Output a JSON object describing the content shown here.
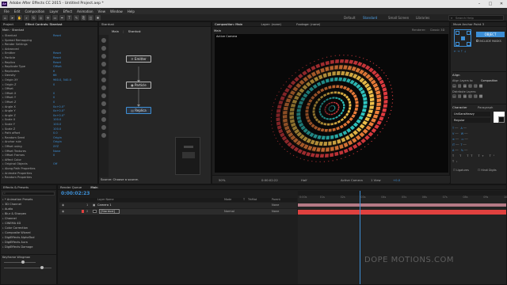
{
  "window": {
    "title": "Adobe After Effects CC 2015 - Untitled Project.aep *",
    "app_badge": "Ae",
    "controls": [
      "–",
      "□",
      "✕"
    ]
  },
  "menu": [
    "File",
    "Edit",
    "Composition",
    "Layer",
    "Effect",
    "Animation",
    "View",
    "Window",
    "Help"
  ],
  "toolbar": {
    "workspaces": [
      "Default",
      "Standard",
      "Small Screen",
      "Libraries"
    ],
    "search_placeholder": "Search Help"
  },
  "project_panel": {
    "tab": "Project",
    "effect_controls_tab": "Effect Controls: Stardust",
    "header": "Main · Stardust",
    "rows": [
      {
        "label": "Stardust",
        "value": "Reset"
      },
      {
        "label": "Spread Remapping",
        "value": ""
      },
      {
        "label": "Render Settings",
        "value": ""
      },
      {
        "label": "Advanced",
        "value": ""
      },
      {
        "label": "Emitter",
        "value": "Reset"
      },
      {
        "label": "Particle",
        "value": "Reset"
      },
      {
        "label": "Replica",
        "value": "Reset"
      },
      {
        "label": "Replicate Type",
        "value": "Offset"
      },
      {
        "label": "Replicates",
        "value": "6"
      },
      {
        "label": "Density",
        "value": "66"
      },
      {
        "label": "Origin XY",
        "value": "960.0, 540.0"
      },
      {
        "label": "Origin Z",
        "value": "0"
      },
      {
        "label": "Offset",
        "value": ""
      },
      {
        "label": "Offset X",
        "value": "0"
      },
      {
        "label": "Offset Y",
        "value": "0"
      },
      {
        "label": "Offset Z",
        "value": "0"
      },
      {
        "label": "Angle X",
        "value": "0x+0.0°"
      },
      {
        "label": "Angle Y",
        "value": "0x+0.0°"
      },
      {
        "label": "Angle Z",
        "value": "0x+0.0°"
      },
      {
        "label": "Scale X",
        "value": "100.0"
      },
      {
        "label": "Scale Y",
        "value": "100.0"
      },
      {
        "label": "Scale Z",
        "value": "100.0"
      },
      {
        "label": "Path offset",
        "value": "0.0"
      },
      {
        "label": "Random Seed",
        "value": "Origin"
      },
      {
        "label": "Anchor rule",
        "value": "Origin"
      },
      {
        "label": "Offset using",
        "value": "XYZ"
      },
      {
        "label": "Offset Textures",
        "value": "None"
      },
      {
        "label": "Offset Frames",
        "value": "0"
      },
      {
        "label": "Affect Color",
        "value": ""
      },
      {
        "label": "Original Objects",
        "value": "Off"
      },
      {
        "label": "Along Path Properties",
        "value": ""
      },
      {
        "label": "Animate Properties",
        "value": ""
      },
      {
        "label": "Random Properties",
        "value": ""
      }
    ]
  },
  "flow_panel": {
    "tab": "Stardust",
    "breadcrumb": [
      "Main",
      "Stardust"
    ],
    "nodes": [
      "Emitter",
      "Particle",
      "Replica"
    ],
    "status": "Source: Choose a source."
  },
  "comp_panel": {
    "tabs": [
      "Composition: Main",
      "Layer: (none)",
      "Footage: (none)"
    ],
    "sub_tabs": [
      "Main"
    ],
    "renderer": "Renderer:",
    "renderer_value": "Classic 3D",
    "camera_label": "Active Camera",
    "footer": {
      "zoom": "50%",
      "timecode": "0:00:02:22",
      "quality": "Half",
      "view": "Active Camera",
      "views": "1 View",
      "exposure": "+0.0"
    }
  },
  "right_panel": {
    "tab": "Move Anchor Point 3",
    "object_button": "OBJECT",
    "checkbox_label": "INCLUDE MASKS",
    "align_tab": "Align",
    "align_label": "Align Layers to:",
    "align_target": "Composition",
    "distribute_label": "Distribute Layers:",
    "character_tab": "Character",
    "paragraph_tab": "Paragraph",
    "font": "UniSansHeavy",
    "font_style": "Regular",
    "ligatures": "Ligatures",
    "hindi_digits": "Hindi Digits"
  },
  "effects_panel": {
    "tab": "Effects & Presets",
    "search_placeholder": "",
    "items": [
      "* Animation Presets",
      "3D Channel",
      "Audio",
      "Blur & Sharpen",
      "Channel",
      "CINEMA 4D",
      "Color Correction",
      "Composite Wizard",
      "DigiEffects AlphaTool",
      "DigiEffects Aura",
      "DigiEffects Damage"
    ],
    "keyframe_tab": "Keyframe Wingman"
  },
  "timeline": {
    "tabs": [
      "Render Queue",
      "Main"
    ],
    "timecode": "0:00:02:23",
    "columns": [
      "Layer Name",
      "Mode",
      "T",
      "TrkMat",
      "Parent"
    ],
    "layers": [
      {
        "index": "1",
        "name": "Camera 1",
        "mode": "",
        "parent": "None"
      },
      {
        "index": "2",
        "name": "[Stardust]",
        "mode": "Normal",
        "parent": "None"
      }
    ],
    "ruler": [
      "0:00s",
      "01s",
      "02s",
      "03s",
      "04s",
      "05s",
      "06s",
      "07s",
      "08s",
      "09s",
      "10s"
    ],
    "playhead_sec": 2.96,
    "duration_sec": 10,
    "watermark": "DOPE MOTIONS.COM"
  },
  "colors": {
    "accent_blue": "#3d8fd6",
    "layer_red": "#e0413f",
    "camera_bar": "#b57a86",
    "ring_cyan": "#2fc7c2",
    "ring_yellow": "#f2c14b",
    "ring_orange": "#f07e3a",
    "ring_red": "#e03b40"
  }
}
